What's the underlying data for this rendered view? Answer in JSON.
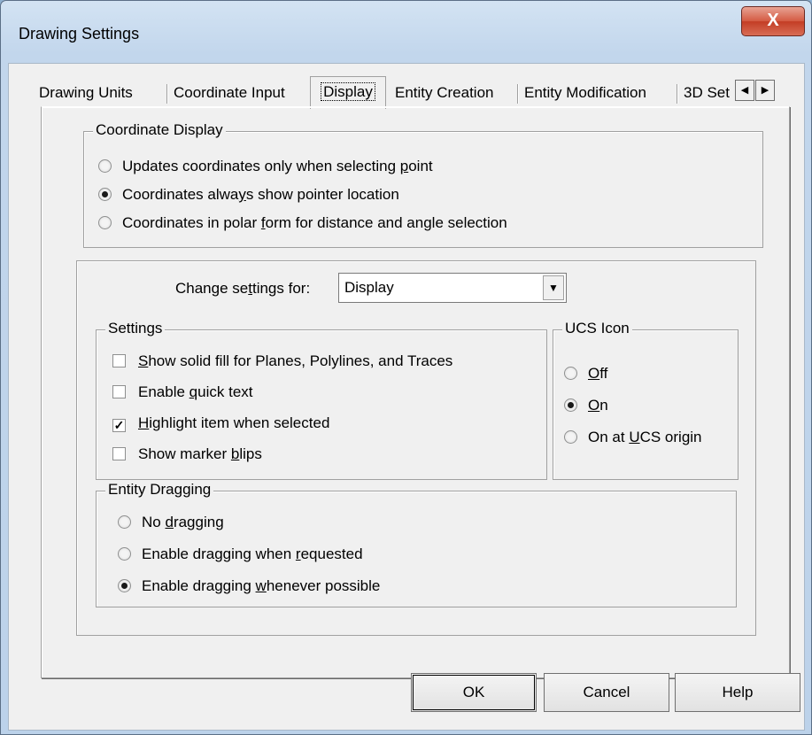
{
  "window": {
    "title": "Drawing Settings",
    "close_glyph": "X"
  },
  "tabs": [
    {
      "label": "Drawing Units"
    },
    {
      "label": "Coordinate Input"
    },
    {
      "label": "Display"
    },
    {
      "label": "Entity Creation"
    },
    {
      "label": "Entity Modification"
    },
    {
      "label": "3D Set"
    }
  ],
  "active_tab": "Display",
  "coordinate_display": {
    "title": "Coordinate Display",
    "options": [
      {
        "label_pre": "Updates coordinates only when selecting ",
        "label_u": "p",
        "label_post": "oint",
        "selected": false
      },
      {
        "label_pre": "Coordinates alwa",
        "label_u": "y",
        "label_post": "s show pointer location",
        "selected": true
      },
      {
        "label_pre": "Coordinates in polar ",
        "label_u": "f",
        "label_post": "orm for distance and angle selection",
        "selected": false
      }
    ]
  },
  "change_settings": {
    "label_pre": "Change se",
    "label_u": "t",
    "label_post": "tings for:",
    "value": "Display"
  },
  "settings": {
    "title": "Settings",
    "items": [
      {
        "label_pre": "",
        "label_u": "S",
        "label_post": "how solid fill for Planes, Polylines, and Traces",
        "checked": false
      },
      {
        "label_pre": "Enable ",
        "label_u": "q",
        "label_post": "uick text",
        "checked": false
      },
      {
        "label_pre": "",
        "label_u": "H",
        "label_post": "ighlight item when selected",
        "checked": true
      },
      {
        "label_pre": "Show marker ",
        "label_u": "b",
        "label_post": "lips",
        "checked": false
      }
    ]
  },
  "ucs_icon": {
    "title": "UCS Icon",
    "options": [
      {
        "label_pre": "",
        "label_u": "O",
        "label_post": "ff",
        "selected": false
      },
      {
        "label_pre": "",
        "label_u": "O",
        "label_post": "n",
        "selected": true
      },
      {
        "label_pre": "On at ",
        "label_u": "U",
        "label_post": "CS origin",
        "selected": false
      }
    ]
  },
  "entity_dragging": {
    "title": "Entity Dragging",
    "options": [
      {
        "label_pre": "No ",
        "label_u": "d",
        "label_post": "ragging",
        "selected": false
      },
      {
        "label_pre": "Enable dragging when ",
        "label_u": "r",
        "label_post": "equested",
        "selected": false
      },
      {
        "label_pre": "Enable dragging ",
        "label_u": "w",
        "label_post": "henever possible",
        "selected": true
      }
    ]
  },
  "buttons": {
    "ok": "OK",
    "cancel": "Cancel",
    "help": "Help"
  },
  "colors": {
    "title_bar": "#c7daf0",
    "close_button": "#c9452e",
    "dialog_bg": "#f0f0f0"
  }
}
